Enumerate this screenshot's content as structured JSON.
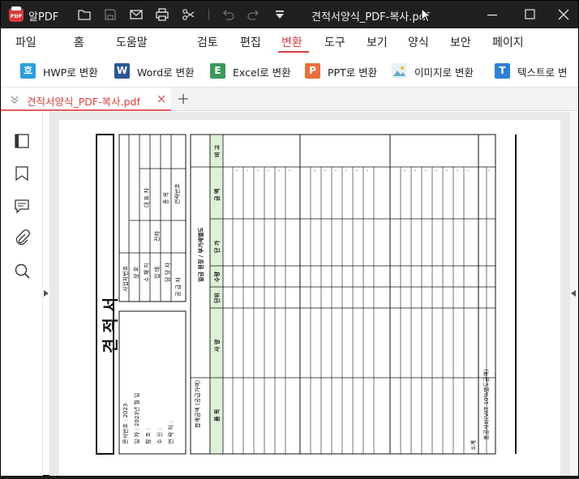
{
  "app": {
    "name": "알PDF",
    "document_title": "견적서양식_PDF-복사.pdf"
  },
  "menu": [
    "파일",
    "홈",
    "도움말",
    "검토",
    "편집",
    "변환",
    "도구",
    "보기",
    "양식",
    "보안",
    "페이지"
  ],
  "active_menu": "변환",
  "ribbon": [
    {
      "icon": "hwp-icon",
      "glyph": "호",
      "color": "#2aa0d8",
      "label": "HWP로 변환"
    },
    {
      "icon": "word-icon",
      "glyph": "W",
      "color": "#2b5797",
      "label": "Word로 변환"
    },
    {
      "icon": "excel-icon",
      "glyph": "E",
      "color": "#3a9a5b",
      "label": "Excel로 변환"
    },
    {
      "icon": "ppt-icon",
      "glyph": "P",
      "color": "#e8703a",
      "label": "PPT로 변환"
    },
    {
      "icon": "image-icon",
      "glyph": "",
      "color": "#6aa8c9",
      "label": "이미지로 변환"
    },
    {
      "icon": "text-icon",
      "glyph": "T",
      "color": "#2f7fd6",
      "label": "텍스트로 변"
    }
  ],
  "tab": {
    "label": "견적서양식_PDF-복사.pdf"
  },
  "colors": {
    "accent": "#d64040",
    "header_green": "#dff0d8"
  },
  "estimate": {
    "title": "견 적 서",
    "doc_info": [
      "문서번호 : 2023",
      "일 자 : 2023년 월 일",
      "참 조 :",
      "수 신 :",
      "연 락 처 :"
    ],
    "supplier": {
      "group": "공 급 자",
      "labels": [
        "사업자번호",
        "상 호",
        "소 재 지",
        "업 태",
        "담 당 자"
      ],
      "mid_labels": [
        "대 표 자",
        "종 목"
      ],
      "right_labels": [
        "연락번호"
      ],
      "misc": "전화"
    },
    "summary_title": "일금 원정 / 부가세별도",
    "columns": [
      "비 고",
      "금 액",
      "단 가",
      "수량",
      "단위",
      "사 양",
      "품 목"
    ],
    "total_label": "합계금액 (공급가액)",
    "footer_left": "소계",
    "footer_right": "총공사비(VAT 10%별도금액)"
  }
}
